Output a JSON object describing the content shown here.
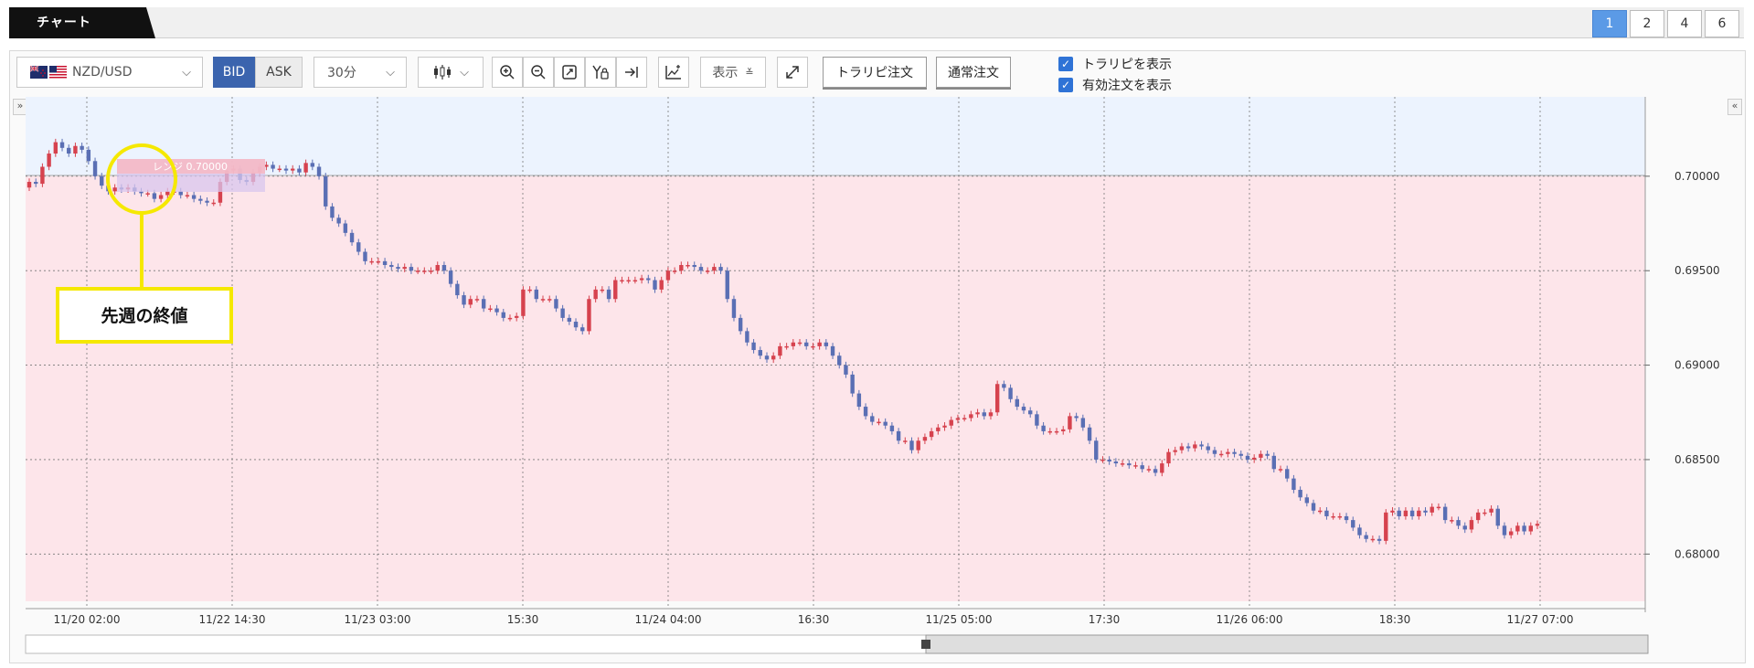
{
  "tab": {
    "title": "チャート"
  },
  "layout_buttons": [
    "1",
    "2",
    "4",
    "6"
  ],
  "toolbar": {
    "pair": "NZD/USD",
    "bid": "BID",
    "ask": "ASK",
    "timeframe": "30分",
    "display": "表示",
    "trap_order": "トラリピ注文",
    "normal_order": "通常注文"
  },
  "checkboxes": [
    "トラリピを表示",
    "有効注文を表示"
  ],
  "annotation": {
    "callout": "先週の終値",
    "range_label": "レンジ 0.70000"
  },
  "colors": {
    "up": "#d6424e",
    "down": "#5a6fb4",
    "range_top": "#ecf3fe",
    "range_bottom": "#fde5ea",
    "highlight": "#f5e800"
  },
  "chart_data": {
    "type": "candlestick",
    "symbol": "NZD/USD",
    "interval": "30分",
    "ylim": [
      0.6775,
      0.7042
    ],
    "yticks": [
      "0.70000",
      "0.69500",
      "0.69000",
      "0.68500",
      "0.68000"
    ],
    "xticks": [
      "11/20 02:00",
      "11/22 14:30",
      "11/23 03:00",
      "15:30",
      "11/24 04:00",
      "16:30",
      "11/25 05:00",
      "17:30",
      "11/26 06:00",
      "18:30",
      "11/27 07:00"
    ],
    "range_line": 0.7,
    "bands": [
      {
        "from": 0.7,
        "to": 0.7042,
        "color": "#ecf3fe"
      },
      {
        "from": 0.6775,
        "to": 0.7,
        "color": "#fde5ea"
      }
    ],
    "series_close": [
      0.6997,
      0.6996,
      0.7005,
      0.7012,
      0.7018,
      0.7015,
      0.7012,
      0.7016,
      0.7014,
      0.7008,
      0.7,
      0.6995,
      0.6992,
      0.6994,
      0.6993,
      0.6994,
      0.6992,
      0.6991,
      0.6991,
      0.6988,
      0.699,
      0.6992,
      0.6992,
      0.699,
      0.699,
      0.6988,
      0.6987,
      0.6986,
      0.6986,
      0.6997,
      0.7003,
      0.7004,
      0.6998,
      0.6997,
      0.7002,
      0.7005,
      0.7006,
      0.7004,
      0.7004,
      0.7003,
      0.7004,
      0.7002,
      0.7007,
      0.7005,
      0.7,
      0.6984,
      0.6978,
      0.6975,
      0.697,
      0.6965,
      0.696,
      0.6955,
      0.6955,
      0.6955,
      0.6953,
      0.6952,
      0.6951,
      0.6952,
      0.695,
      0.695,
      0.695,
      0.695,
      0.6953,
      0.695,
      0.6943,
      0.6937,
      0.6932,
      0.6935,
      0.6935,
      0.693,
      0.693,
      0.6928,
      0.6925,
      0.6925,
      0.6926,
      0.694,
      0.694,
      0.6935,
      0.6935,
      0.6935,
      0.693,
      0.6925,
      0.6923,
      0.692,
      0.6918,
      0.6935,
      0.694,
      0.694,
      0.6935,
      0.6945,
      0.6945,
      0.6945,
      0.6945,
      0.6946,
      0.6945,
      0.694,
      0.6945,
      0.695,
      0.695,
      0.6953,
      0.6953,
      0.6952,
      0.695,
      0.695,
      0.6952,
      0.695,
      0.6935,
      0.6925,
      0.6918,
      0.6912,
      0.6908,
      0.6905,
      0.6903,
      0.6905,
      0.691,
      0.691,
      0.6912,
      0.6912,
      0.691,
      0.691,
      0.6912,
      0.691,
      0.6905,
      0.69,
      0.6895,
      0.6885,
      0.6878,
      0.6873,
      0.687,
      0.687,
      0.6868,
      0.6865,
      0.686,
      0.686,
      0.6855,
      0.686,
      0.6862,
      0.6865,
      0.6867,
      0.6868,
      0.6871,
      0.6872,
      0.6872,
      0.6874,
      0.6875,
      0.6873,
      0.6875,
      0.689,
      0.6888,
      0.6882,
      0.6878,
      0.6876,
      0.6874,
      0.6868,
      0.6865,
      0.6865,
      0.6865,
      0.6866,
      0.6873,
      0.6872,
      0.6867,
      0.686,
      0.685,
      0.685,
      0.6849,
      0.6848,
      0.6848,
      0.6847,
      0.6847,
      0.6845,
      0.6845,
      0.6843,
      0.6848,
      0.6854,
      0.6855,
      0.6857,
      0.6856,
      0.6858,
      0.6857,
      0.6855,
      0.6853,
      0.6853,
      0.6854,
      0.6853,
      0.6852,
      0.685,
      0.6851,
      0.6853,
      0.6852,
      0.6845,
      0.6845,
      0.684,
      0.6834,
      0.683,
      0.6827,
      0.6823,
      0.6823,
      0.682,
      0.682,
      0.682,
      0.6818,
      0.6814,
      0.681,
      0.6808,
      0.6808,
      0.6807,
      0.6822,
      0.6823,
      0.682,
      0.6823,
      0.682,
      0.6823,
      0.6822,
      0.6825,
      0.6825,
      0.6818,
      0.6818,
      0.6815,
      0.6813,
      0.6818,
      0.6822,
      0.6822,
      0.6824,
      0.6815,
      0.681,
      0.6812,
      0.6815,
      0.6812,
      0.6815,
      0.6816
    ]
  }
}
